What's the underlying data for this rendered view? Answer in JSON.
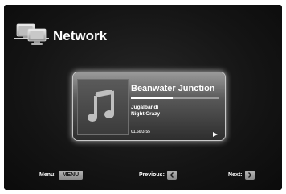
{
  "header": {
    "title": "Network",
    "icon": "network-computers-icon"
  },
  "now_playing": {
    "track_title": "Beanwater Junction",
    "artist": "Jugalbandi",
    "album": "Night Crazy",
    "time": "01.50/3:55",
    "progress": 0.47,
    "album_art_icon": "music-note-icon",
    "status_icon": "play-icon"
  },
  "controls": {
    "menu_label": "Menu:",
    "menu_button": "MENU",
    "previous_label": "Previous:",
    "previous_icon": "chevron-left-icon",
    "next_label": "Next:",
    "next_icon": "chevron-right-icon"
  }
}
